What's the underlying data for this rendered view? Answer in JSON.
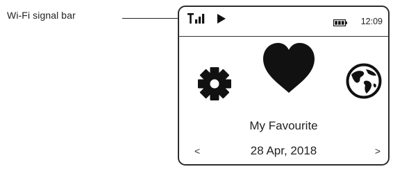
{
  "callout": {
    "label": "Wi-Fi signal bar"
  },
  "status_bar": {
    "signal_icon": "wifi-signal-bars-icon",
    "playback_icon": "play-icon",
    "battery_icon": "battery-icon",
    "time": "12:09"
  },
  "menu": {
    "left_icon": "gear-icon",
    "center_icon": "heart-icon",
    "right_icon": "globe-icon",
    "selected_label": "My Favourite"
  },
  "date_bar": {
    "prev_label": "<",
    "date": "28 Apr, 2018",
    "next_label": ">"
  }
}
